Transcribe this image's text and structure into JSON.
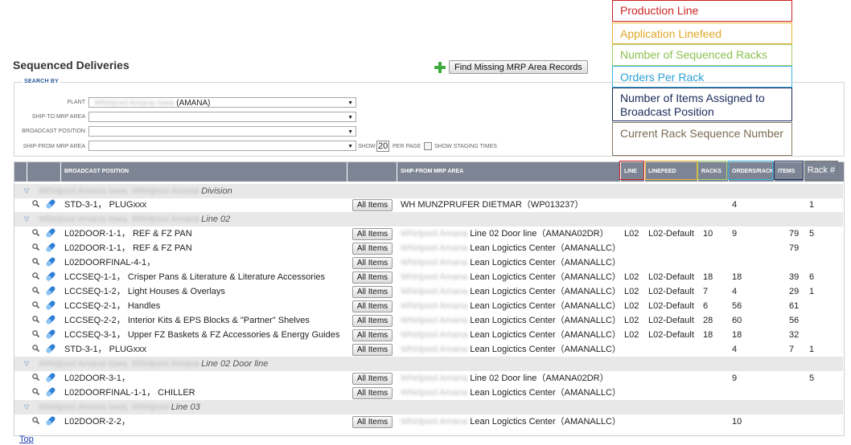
{
  "legend": [
    "Production Line",
    "Application Linefeed",
    "Number of Sequenced Racks",
    "Orders Per Rack",
    "Number of Items Assigned to Broadcast Position",
    "Current Rack Sequence Number"
  ],
  "page_title": "Sequenced Deliveries",
  "find_missing_label": "Find Missing MRP Area Records",
  "search": {
    "legend": "SEARCH BY",
    "plant_label": "PLANT",
    "plant_value_blur": "Whirlpool Amana Iowa",
    "plant_value": "(AMANA)",
    "ship_to_label": "SHIP-TO MRP AREA",
    "broadcast_label": "BROADCAST POSITION",
    "ship_from_label": "SHIP-FROM MRP AREA",
    "show_label": "SHOW",
    "per_page": "20",
    "per_page_label": "PER PAGE",
    "staging_label": "SHOW STAGING TIMES"
  },
  "columns": {
    "broadcast": "BROADCAST POSITION",
    "ship_from": "SHIP-FROM MRP AREA",
    "line": "LINE",
    "linefeed": "LINEFEED",
    "racks": "RACKS",
    "orders": "ORDERS/RACK",
    "items": "ITEMS",
    "rack_no": "Rack #"
  },
  "all_items_label": "All Items",
  "groups": [
    {
      "blur": "Whirlpool Amana Iowa, Whirlpool Amana",
      "suffix": "Division"
    },
    {
      "blur": "Whirlpool Amana Iowa, Whirlpool Amana",
      "suffix": "Line 02"
    },
    {
      "blur": "Whirlpool Amana Iowa, Whirlpool Amana",
      "suffix": "Line 02 Door line"
    },
    {
      "blur": "Whirlpool Amana Iowa, Whirlpool",
      "suffix": "Line 03"
    }
  ],
  "rows": [
    {
      "pos": "STD-3-1， PLUGxxx",
      "sf_blur": "",
      "sf": "WH MUNZPRUFER DIETMAR（WP013237）",
      "line": "",
      "linefeed": "",
      "racks": "",
      "orders": "4",
      "items": "",
      "rack": "1"
    },
    {
      "pos": "L02DOOR-1-1， REF & FZ PAN",
      "sf_blur": "Whirlpool Amana",
      "sf": "Line 02 Door line（AMANA02DR）",
      "line": "L02",
      "linefeed": "L02-Default",
      "racks": "10",
      "orders": "9",
      "items": "79",
      "rack": "5"
    },
    {
      "pos": "L02DOOR-1-1， REF & FZ PAN",
      "sf_blur": "Whirlpool Amana",
      "sf": "Lean Logictics Center（AMANALLC）",
      "line": "",
      "linefeed": "",
      "racks": "",
      "orders": "",
      "items": "79",
      "rack": ""
    },
    {
      "pos": "L02DOORFINAL-4-1，",
      "sf_blur": "Whirlpool Amana",
      "sf": "Lean Logictics Center（AMANALLC）",
      "line": "",
      "linefeed": "",
      "racks": "",
      "orders": "",
      "items": "",
      "rack": ""
    },
    {
      "pos": "LCCSEQ-1-1， Crisper Pans & Literature & Literature Accessories",
      "sf_blur": "Whirlpool Amana",
      "sf": "Lean Logictics Center（AMANALLC）",
      "line": "L02",
      "linefeed": "L02-Default",
      "racks": "18",
      "orders": "18",
      "items": "39",
      "rack": "6"
    },
    {
      "pos": "LCCSEQ-1-2， Light Houses & Overlays",
      "sf_blur": "Whirlpool Amana",
      "sf": "Lean Logictics Center（AMANALLC）",
      "line": "L02",
      "linefeed": "L02-Default",
      "racks": "7",
      "orders": "4",
      "items": "29",
      "rack": "1"
    },
    {
      "pos": "LCCSEQ-2-1， Handles",
      "sf_blur": "Whirlpool Amana",
      "sf": "Lean Logictics Center（AMANALLC）",
      "line": "L02",
      "linefeed": "L02-Default",
      "racks": "6",
      "orders": "56",
      "items": "61",
      "rack": ""
    },
    {
      "pos": "LCCSEQ-2-2， Interior Kits & EPS Blocks & \"Partner\" Shelves",
      "sf_blur": "Whirlpool Amana",
      "sf": "Lean Logictics Center（AMANALLC）",
      "line": "L02",
      "linefeed": "L02-Default",
      "racks": "28",
      "orders": "60",
      "items": "56",
      "rack": ""
    },
    {
      "pos": "LCCSEQ-3-1， Upper FZ Baskets & FZ Accessories & Energy Guides",
      "sf_blur": "Whirlpool Amana",
      "sf": "Lean Logictics Center（AMANALLC）",
      "line": "L02",
      "linefeed": "L02-Default",
      "racks": "18",
      "orders": "18",
      "items": "32",
      "rack": ""
    },
    {
      "pos": "STD-3-1， PLUGxxx",
      "sf_blur": "Whirlpool Amana",
      "sf": "Lean Logictics Center（AMANALLC）",
      "line": "",
      "linefeed": "",
      "racks": "",
      "orders": "4",
      "items": "7",
      "rack": "1"
    },
    {
      "pos": "L02DOOR-3-1，",
      "sf_blur": "Whirlpool Amana",
      "sf": "Line 02 Door line（AMANA02DR）",
      "line": "",
      "linefeed": "",
      "racks": "",
      "orders": "9",
      "items": "",
      "rack": "5"
    },
    {
      "pos": "L02DOORFINAL-1-1， CHILLER",
      "sf_blur": "Whirlpool Amana",
      "sf": "Lean Logictics Center（AMANALLC）",
      "line": "",
      "linefeed": "",
      "racks": "",
      "orders": "",
      "items": "",
      "rack": ""
    },
    {
      "pos": "L02DOOR-2-2，",
      "sf_blur": "Whirlpool Amana",
      "sf": "Lean Logictics Center（AMANALLC）",
      "line": "",
      "linefeed": "",
      "racks": "",
      "orders": "10",
      "items": "",
      "rack": ""
    }
  ],
  "top_link": "Top"
}
